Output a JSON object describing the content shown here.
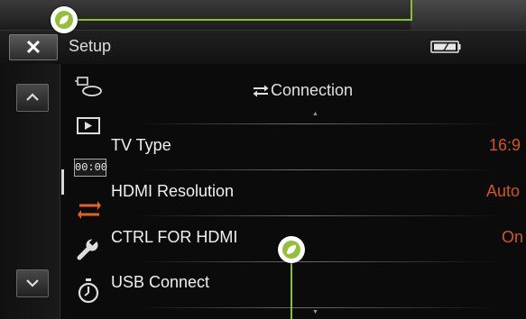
{
  "header": {
    "close_label": "✕",
    "title": "Setup"
  },
  "section": {
    "title": "Connection"
  },
  "menu": [
    {
      "label": "TV Type",
      "value": "16:9"
    },
    {
      "label": "HDMI Resolution",
      "value": "Auto"
    },
    {
      "label": "CTRL FOR HDMI",
      "value": "On"
    },
    {
      "label": "USB Connect",
      "value": ""
    }
  ],
  "sidebar": {
    "timecode_label": "00:00"
  },
  "colors": {
    "accent": "#d2561f",
    "callout": "#8cbf2c"
  }
}
